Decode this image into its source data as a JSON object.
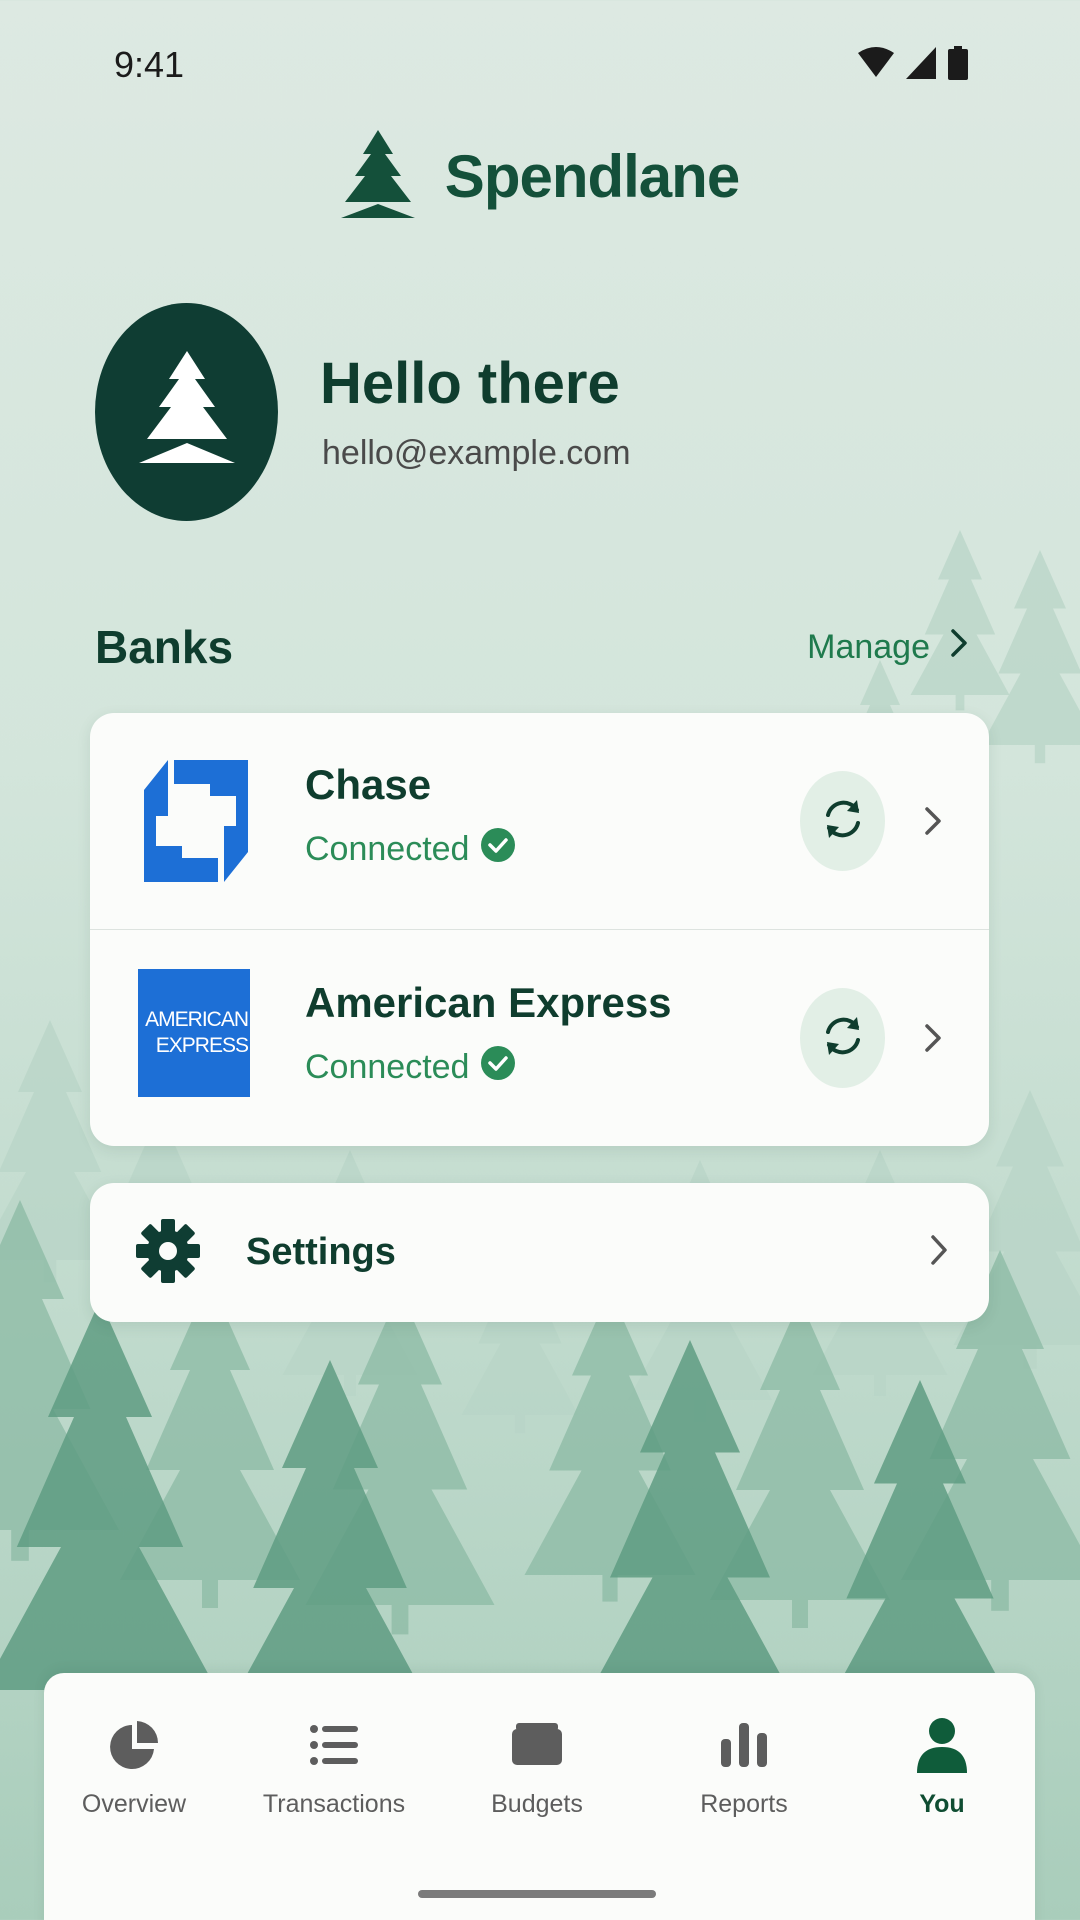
{
  "status_bar": {
    "time": "9:41",
    "icons": [
      "wifi-icon",
      "signal-icon",
      "battery-icon"
    ]
  },
  "app": {
    "name": "Spendlane",
    "logo_icon": "pine-tree-icon"
  },
  "profile": {
    "greeting": "Hello there",
    "email": "hello@example.com",
    "avatar_icon": "pine-tree-icon"
  },
  "banks": {
    "title": "Banks",
    "manage_label": "Manage",
    "items": [
      {
        "name": "Chase",
        "status": "Connected",
        "logo": "chase-logo"
      },
      {
        "name": "American Express",
        "status": "Connected",
        "logo": "amex-logo",
        "logo_text": [
          "AMERICAN",
          "EXPRESS"
        ]
      }
    ]
  },
  "settings": {
    "label": "Settings"
  },
  "bottom_nav": {
    "active": "You",
    "items": [
      {
        "label": "Overview",
        "icon": "pie-chart-icon"
      },
      {
        "label": "Transactions",
        "icon": "list-icon"
      },
      {
        "label": "Budgets",
        "icon": "wallet-icon"
      },
      {
        "label": "Reports",
        "icon": "bar-chart-icon"
      },
      {
        "label": "You",
        "icon": "person-icon"
      }
    ]
  },
  "colors": {
    "primary": "#0f3d33",
    "accent_green": "#2b8c58",
    "chase_blue": "#1d6fd6",
    "amex_blue": "#1d6fd6"
  }
}
